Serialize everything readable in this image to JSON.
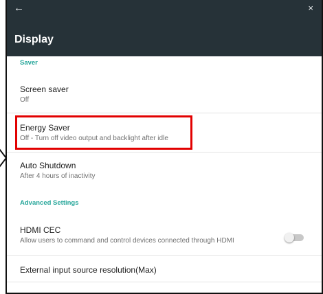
{
  "header": {
    "back_icon": "arrow-left-icon",
    "back_glyph": "←",
    "close_icon": "close-icon",
    "close_glyph": "×",
    "title": "Display"
  },
  "sections": {
    "saver": "Saver",
    "advanced": "Advanced Settings"
  },
  "items": {
    "screen_saver": {
      "title": "Screen saver",
      "subtitle": "Off"
    },
    "energy_saver": {
      "title": "Energy Saver",
      "subtitle": "Off - Turn off video output and backlight after idle"
    },
    "auto_shutdown": {
      "title": "Auto Shutdown",
      "subtitle": "After 4 hours of inactivity"
    },
    "hdmi_cec": {
      "title": "HDMI CEC",
      "subtitle": "Allow users to command and control devices connected through HDMI",
      "enabled": false
    },
    "external_input": {
      "title": "External input source resolution(Max)"
    }
  },
  "colors": {
    "appbar": "#263238",
    "section_header": "#26a69a",
    "highlight_box": "#e20000"
  }
}
